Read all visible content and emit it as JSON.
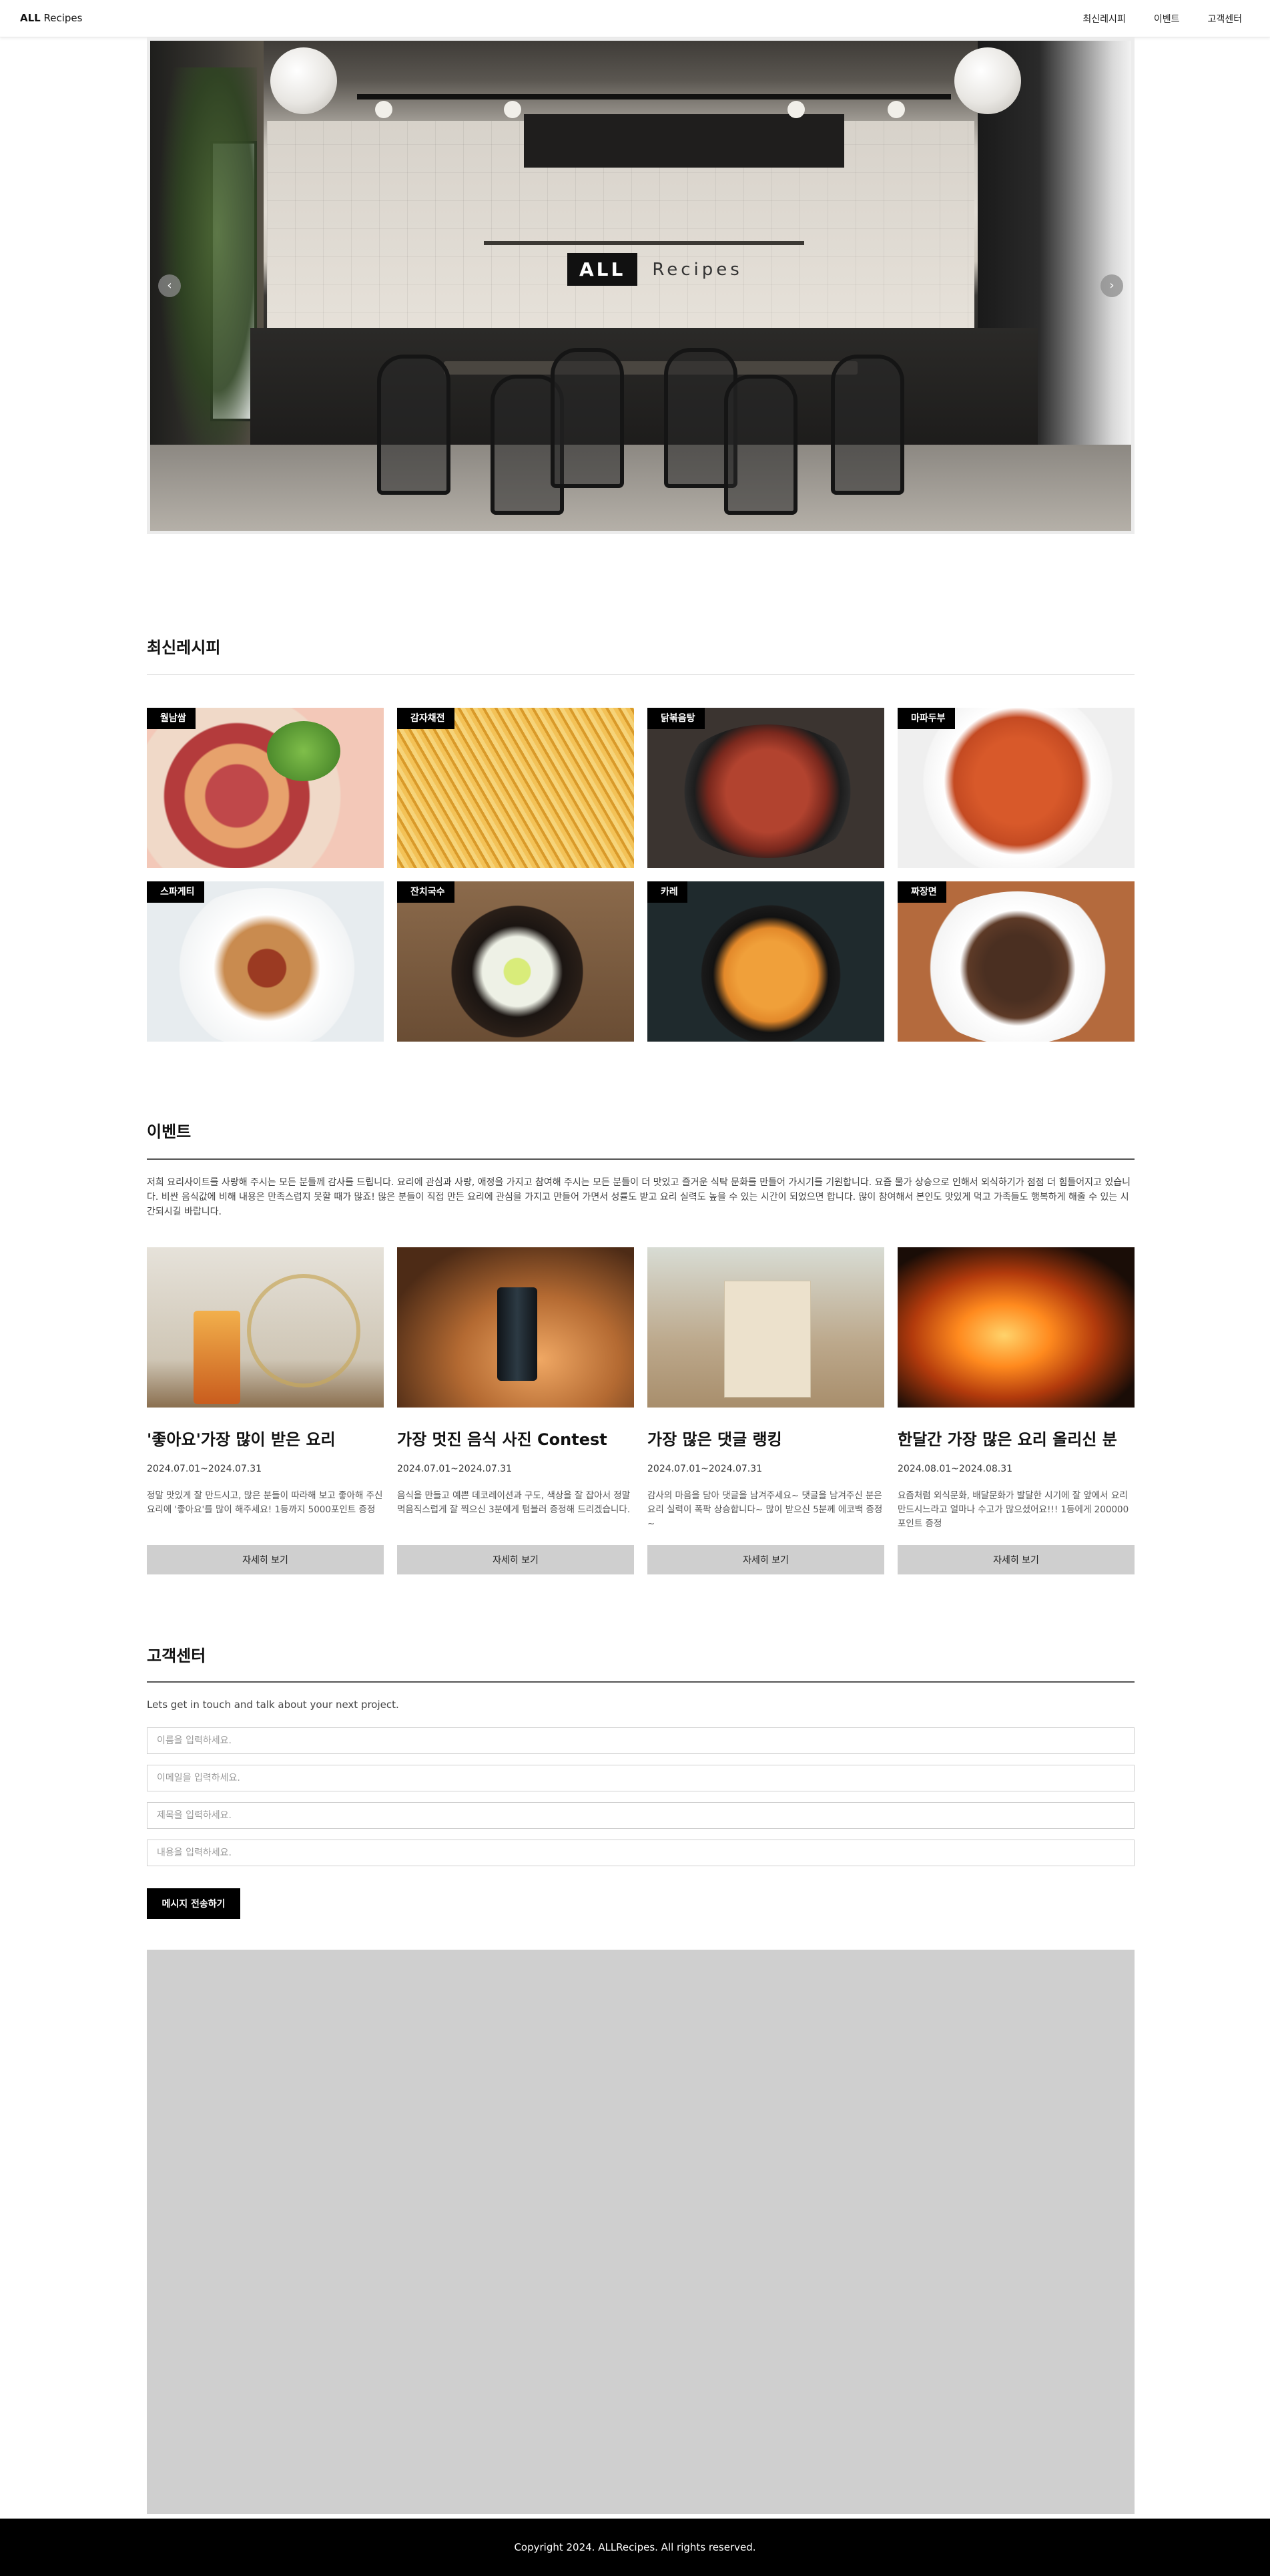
{
  "nav": {
    "brand_bold": "ALL",
    "brand_rest": " Recipes",
    "links": [
      "최신레시피",
      "이벤트",
      "고객센터"
    ]
  },
  "hero": {
    "logo_box": "ALL",
    "logo_text": "Recipes",
    "prev_icon": "chevron-left-icon",
    "next_icon": "chevron-right-icon",
    "prev_glyph": "‹",
    "next_glyph": "›"
  },
  "recipes": {
    "title": "최신레시피",
    "items": [
      {
        "label": "월남쌈"
      },
      {
        "label": "감자채전"
      },
      {
        "label": "닭볶음탕"
      },
      {
        "label": "마파두부"
      },
      {
        "label": "스파게티"
      },
      {
        "label": "잔치국수"
      },
      {
        "label": "카레"
      },
      {
        "label": "짜장면"
      }
    ]
  },
  "events": {
    "title": "이벤트",
    "description": "저희 요리사이트를 사랑해 주시는 모든 분들께 감사를 드립니다. 요리에 관심과 사랑, 애정을 가지고 참여해 주시는 모든 분들이 더 맛있고 즐거운 식탁 문화를 만들어 가시기를 기원합니다. 요즘 물가 상승으로 인해서 외식하기가 점점 더 힘들어지고 있습니다. 비싼 음식값에 비해 내용은 만족스럽지 못할 때가 많죠! 많은 분들이 직접 만든 요리에 관심을 가지고 만들어 가면서 성률도 받고 요리 실력도 높을 수 있는 시간이 되었으면 합니다. 많이 참여해서 본인도 맛있게 먹고 가족들도 행복하게 해줄 수 있는 시간되시길 바랍니다.",
    "button_label": "자세히 보기",
    "items": [
      {
        "title": "'좋아요'가장 많이 받은 요리",
        "date": "2024.07.01~2024.07.31",
        "body": "정말 맛있게 잘 만드시고, 많은 분들이 따라해 보고 좋아해 주신 요리에 '좋아요'를 많이 해주세요! 1등까지 5000포인트 증정"
      },
      {
        "title": "가장 멋진 음식 사진 Contest",
        "date": "2024.07.01~2024.07.31",
        "body": "음식을 만들고 예쁜 데코레이션과 구도, 색상을 잘 잡아서 정말 먹음직스럽게 잘 찍으신 3분에게 텀블러 증정해 드리겠습니다."
      },
      {
        "title": "가장 많은 댓글 랭킹",
        "date": "2024.07.01~2024.07.31",
        "body": "감사의 마음을 담아 댓글을 남겨주세요~ 댓글을 남겨주신 분은 요리 실력이 폭팍 상승합니다~ 많이 받으신 5분께 에코백 증정~"
      },
      {
        "title": "한달간 가장 많은 요리 올리신 분",
        "date": "2024.08.01~2024.08.31",
        "body": "요즘처럼 외식문화, 배달문화가 발달한 시기에 잘 앞에서 요리 만드시느라고 얼마나 수고가 많으셨어요!!! 1등에게 200000포인트 증정"
      }
    ]
  },
  "contact": {
    "title": "고객센터",
    "subtitle": "Lets get in touch and talk about your next project.",
    "name_placeholder": "이름을 입력하세요.",
    "email_placeholder": "이메일을 입력하세요.",
    "subject_placeholder": "제목을 입력하세요.",
    "message_placeholder": "내용을 입력하세요.",
    "send_label": "메시지 전송하기"
  },
  "footer": {
    "text": "Copyright 2024. ALLRecipes. All rights reserved."
  },
  "colors": {
    "accent": "#000000",
    "button_gray": "#cfcfcf",
    "map_gray": "#cfcfcf"
  }
}
